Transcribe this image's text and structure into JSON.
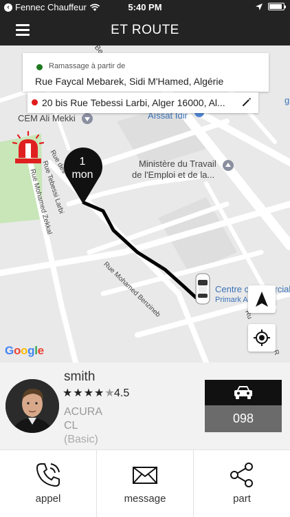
{
  "status_bar": {
    "carrier": "Fennec Chauffeur",
    "time": "5:40 PM"
  },
  "header": {
    "title": "ET ROUTE"
  },
  "trip": {
    "pickup_caption": "Ramassage à partir de",
    "pickup_address": "Rue Faycal Mebarek, Sidi M'Hamed, Algérie",
    "dropoff_address": "20 bis Rue Tebessi Larbi, Alger 16000, Al...",
    "eta_value": "1",
    "eta_unit": "mon"
  },
  "map": {
    "labels": {
      "cem": "CEM Ali Mekki",
      "aissat": "Aïssat Idir",
      "ministry_line1": "Ministère du Travail",
      "ministry_line2": "de l'Emploi et de la...",
      "rue_tebessi": "Rue Tebessi Larbi",
      "rue_des": "Rue des",
      "rue_zekkal": "Rue Mohamed Zekkal",
      "rue_benzineb": "Rue Mohamed Benzineb",
      "centre_line1": "Centre c",
      "centre_line1b": "ercial",
      "centre_line2": "Primark A",
      "partial_be": "Be",
      "partial_g": "g",
      "partial_ru": "Ru",
      "partial_r": "R"
    },
    "google_logo": "Google"
  },
  "driver": {
    "name": "smith",
    "rating": "4.5",
    "rating_stars": 4.5,
    "car_make": "ACURA",
    "car_model": "CL",
    "car_class": "(Basic)",
    "plate": "098"
  },
  "actions": {
    "call": "appel",
    "message": "message",
    "share": "part"
  },
  "colors": {
    "header_bg": "#232323",
    "pickup_dot": "#1f7a1f",
    "dropoff_dot": "#e01b1b",
    "sos_red": "#e02020",
    "route": "#000000"
  }
}
